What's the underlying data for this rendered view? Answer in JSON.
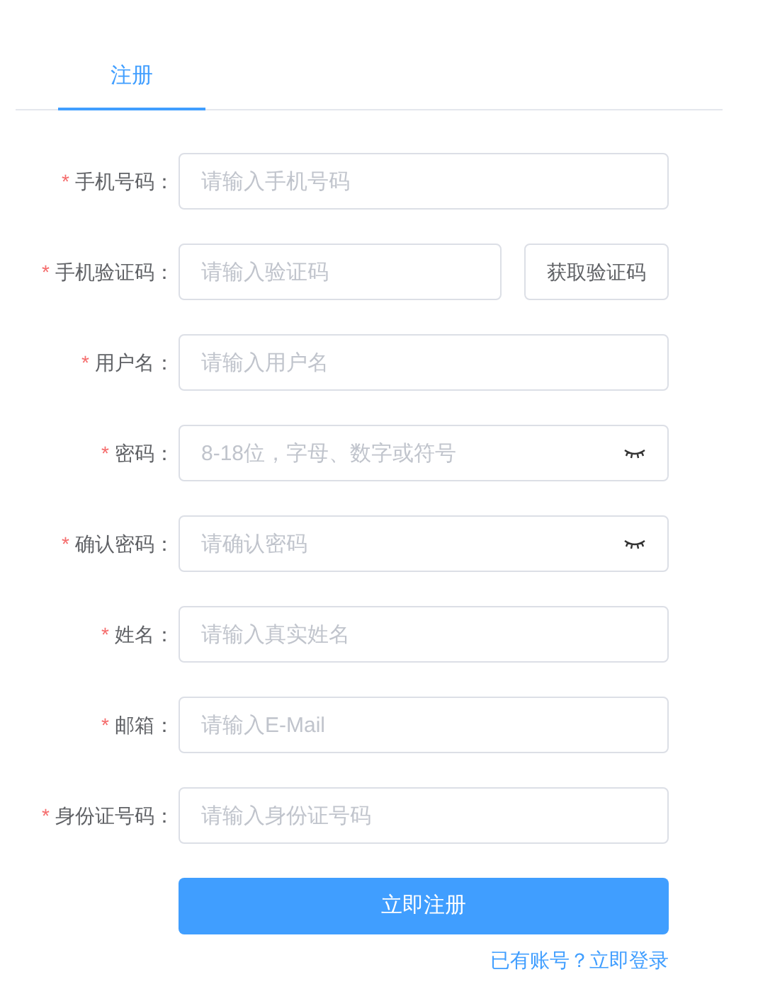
{
  "tabs": [
    {
      "label": "注册",
      "selected": true
    }
  ],
  "fields": [
    {
      "kind": "text",
      "mark": "*",
      "label": "手机号码：",
      "placeholder": "请输入手机号码"
    },
    {
      "kind": "code",
      "mark": "*",
      "label": "手机验证码：",
      "placeholder": "请输入验证码",
      "button": "获取验证码"
    },
    {
      "kind": "text",
      "mark": "*",
      "label": "用户名：",
      "placeholder": "请输入用户名"
    },
    {
      "kind": "password",
      "mark": "*",
      "label": "密码：",
      "placeholder": "8-18位，字母、数字或符号"
    },
    {
      "kind": "password",
      "mark": "*",
      "label": "确认密码：",
      "placeholder": "请确认密码"
    },
    {
      "kind": "text",
      "mark": "*",
      "label": "姓名：",
      "placeholder": "请输入真实姓名"
    },
    {
      "kind": "text",
      "mark": "*",
      "label": "邮箱：",
      "placeholder": "请输入E-Mail"
    },
    {
      "kind": "text",
      "mark": "*",
      "label": "身份证号码：",
      "placeholder": "请输入身份证号码"
    }
  ],
  "submit": "立即注册",
  "login_link": "已有账号？立即登录"
}
